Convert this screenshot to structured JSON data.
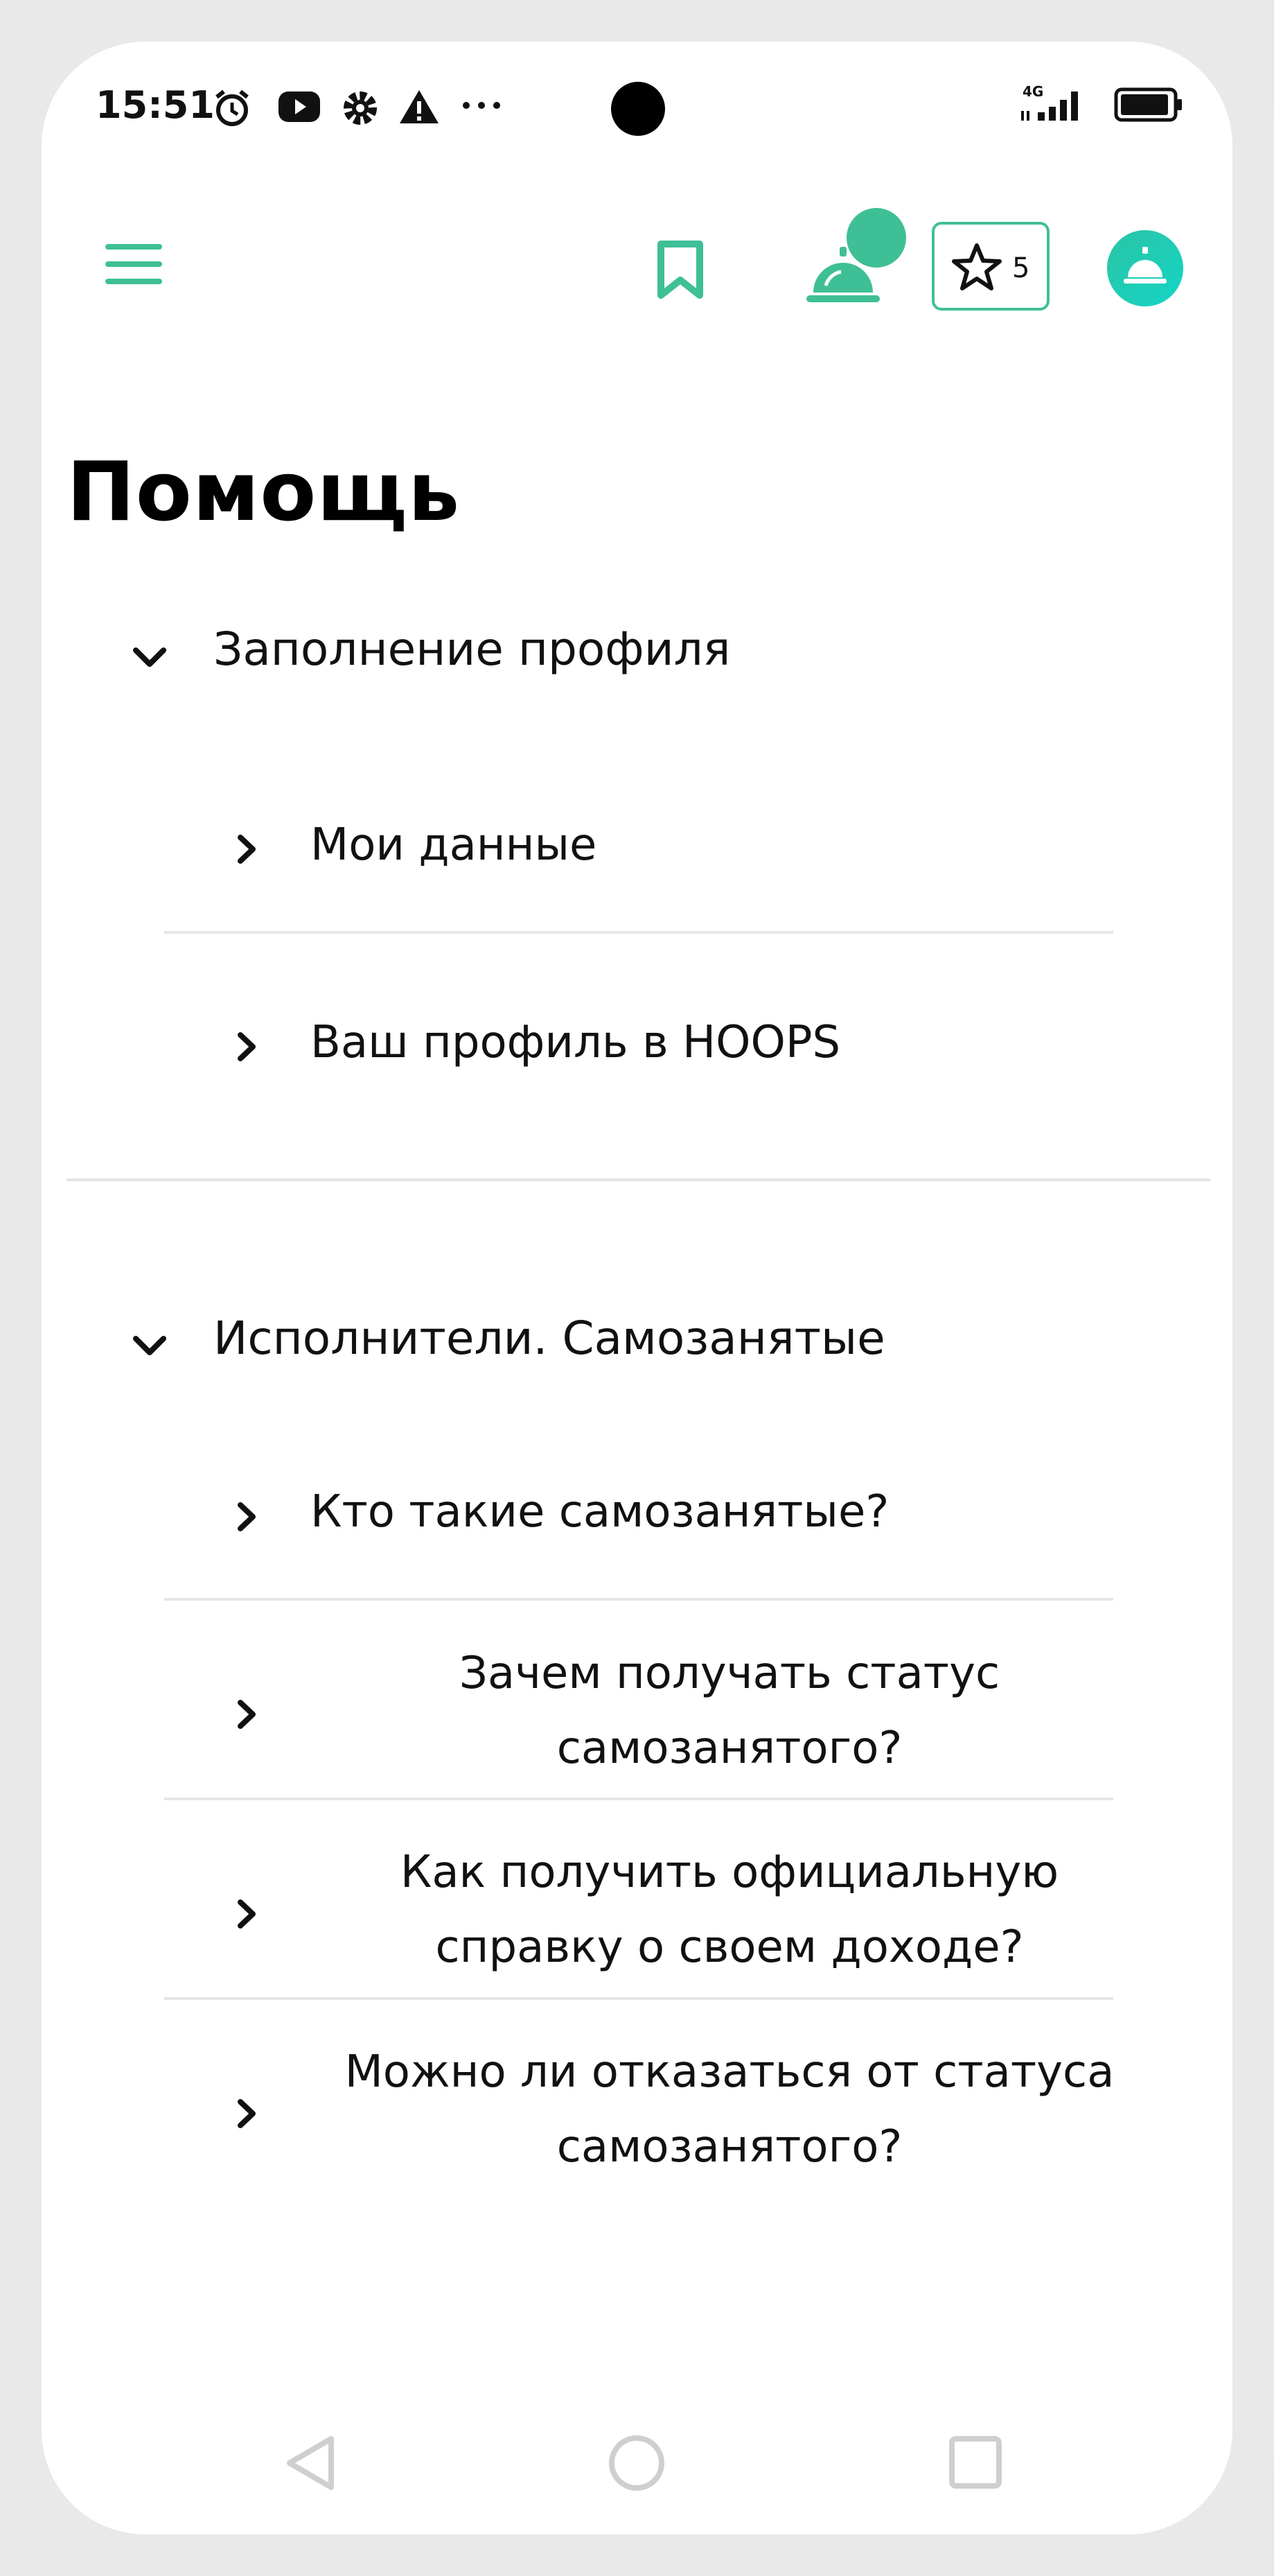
{
  "status_bar": {
    "time": "15:51",
    "icons": [
      "alarm-icon",
      "youtube-icon",
      "settings-icon",
      "warning-icon",
      "more-icon"
    ],
    "network": "4G",
    "battery": "battery-icon"
  },
  "header": {
    "menu_icon": "hamburger-menu-icon",
    "bookmark_icon": "bookmark-icon",
    "service_icon": "service-bell-icon",
    "favorites_count": "5",
    "accent_color": "#3fbf96"
  },
  "page_title": "Помощь",
  "sections": [
    {
      "title": "Заполнение профиля",
      "items": [
        "Мои данные",
        "Ваш профиль в HOOPS"
      ]
    },
    {
      "title": "Исполнители. Самозанятые",
      "items": [
        "Кто такие самозанятые?",
        "Зачем получать статус самозанятого?",
        "Как получить официальную справку о своем доходе?",
        "Можно ли отказаться от статуса самозанятого?"
      ]
    }
  ],
  "nav_bar": [
    "back-icon",
    "home-icon",
    "recents-icon"
  ]
}
